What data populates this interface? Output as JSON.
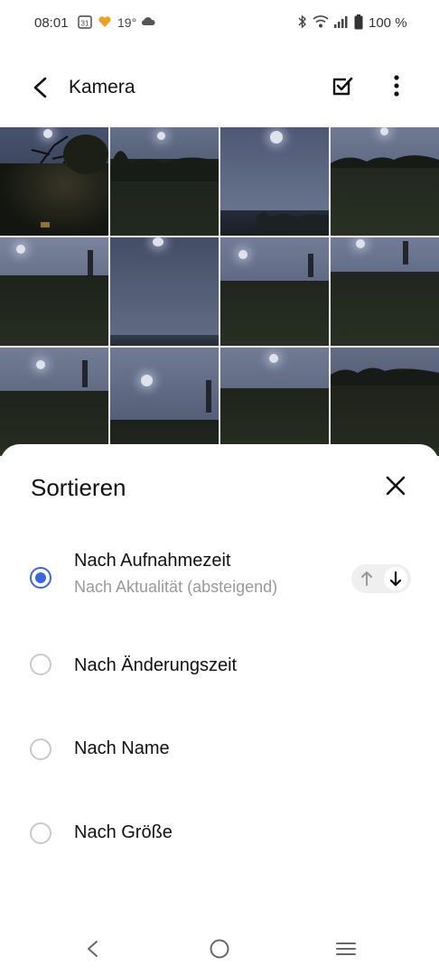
{
  "status_bar": {
    "time": "08:01",
    "calendar_day": "31",
    "temperature": "19°",
    "battery": "100 %",
    "icons": [
      "calendar-icon",
      "notification-heart-icon",
      "weather-cloud-icon",
      "bluetooth-icon",
      "wifi-icon",
      "signal-icon",
      "battery-icon"
    ]
  },
  "app_bar": {
    "title": "Kamera",
    "back_icon": "back-arrow-icon",
    "select_icon": "checkbox-select-icon",
    "more_icon": "more-vertical-icon"
  },
  "gallery": {
    "thumbnail_count": 12,
    "description_hint": "night photos with moon"
  },
  "sort_sheet": {
    "title": "Sortieren",
    "close_icon": "close-icon",
    "options": [
      {
        "label": "Nach Aufnahmezeit",
        "sublabel": "Nach Aktualität (absteigend)",
        "selected": true
      },
      {
        "label": "Nach Änderungszeit",
        "selected": false
      },
      {
        "label": "Nach Name",
        "selected": false
      },
      {
        "label": "Nach Größe",
        "selected": false
      }
    ],
    "direction": {
      "ascending_icon": "arrow-up-icon",
      "descending_icon": "arrow-down-icon",
      "active": "descending"
    }
  },
  "nav_bar": {
    "icons": [
      "nav-back-icon",
      "nav-home-icon",
      "nav-recents-icon"
    ]
  },
  "colors": {
    "accent": "#3a66dd",
    "radio_off": "#c9c9c9",
    "subtext": "#9a9a9a"
  }
}
